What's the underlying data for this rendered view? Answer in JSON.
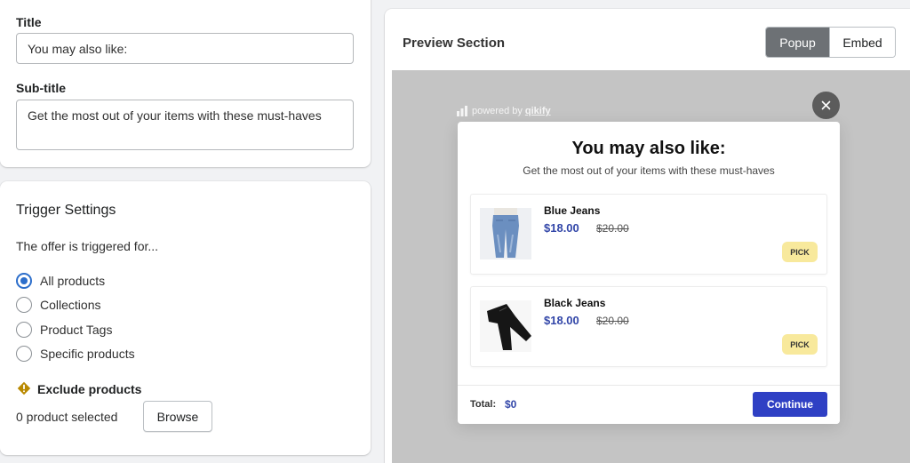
{
  "offer_text": {
    "title_label": "Title",
    "title_value": "You may also like:",
    "subtitle_label": "Sub-title",
    "subtitle_value": "Get the most out of your items with these must-haves"
  },
  "trigger": {
    "heading": "Trigger Settings",
    "description": "The offer is triggered for...",
    "options": [
      {
        "label": "All products",
        "selected": true
      },
      {
        "label": "Collections",
        "selected": false
      },
      {
        "label": "Product Tags",
        "selected": false
      },
      {
        "label": "Specific products",
        "selected": false
      }
    ],
    "exclude_label": "Exclude products",
    "selected_count": "0 product selected",
    "browse_label": "Browse"
  },
  "preview": {
    "heading": "Preview Section",
    "tabs": [
      {
        "label": "Popup",
        "active": true
      },
      {
        "label": "Embed",
        "active": false
      }
    ],
    "powered_by": "powered by",
    "brand": "qikify",
    "popup": {
      "title": "You may also like:",
      "subtitle": "Get the most out of your items with these must-haves",
      "products": [
        {
          "name": "Blue Jeans",
          "price": "$18.00",
          "compare_price": "$20.00",
          "pick_label": "PICK"
        },
        {
          "name": "Black Jeans",
          "price": "$18.00",
          "compare_price": "$20.00",
          "pick_label": "PICK"
        }
      ],
      "total_label": "Total:",
      "total_value": "$0",
      "continue_label": "Continue"
    }
  },
  "colors": {
    "accent": "#2c6ecb",
    "price": "#3246a8",
    "continue_button": "#2f40c4",
    "pick_badge": "#f8e99c",
    "warning": "#b98900"
  }
}
